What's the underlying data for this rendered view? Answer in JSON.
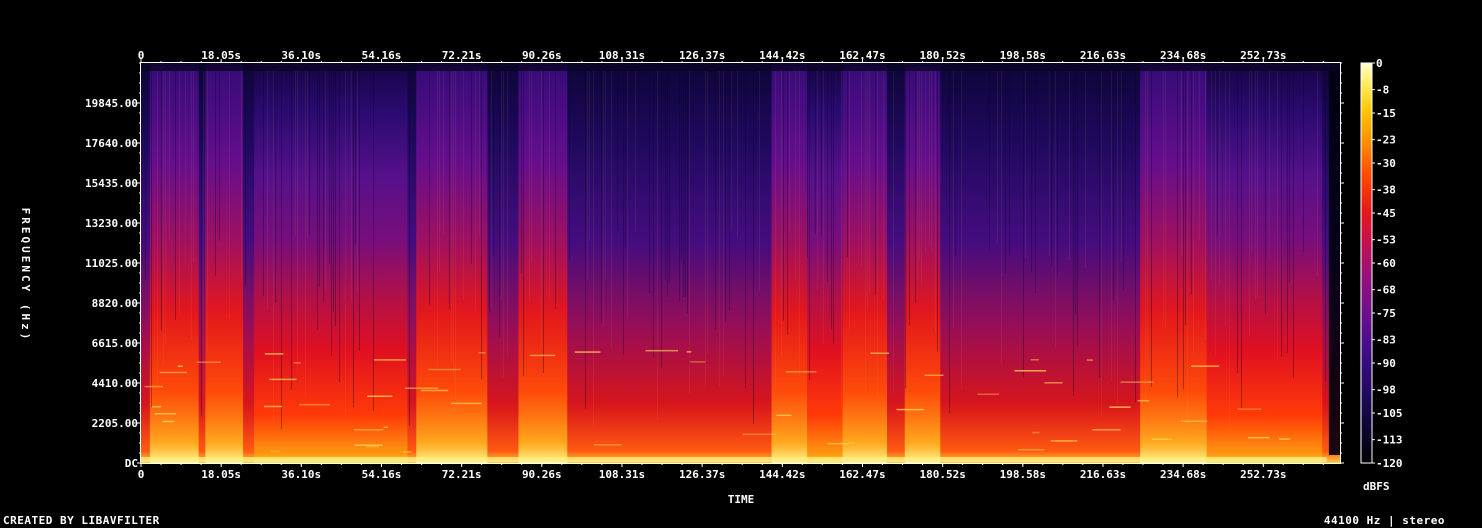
{
  "chart_data": {
    "type": "heatmap",
    "title": "",
    "xlabel": "TIME",
    "ylabel": "FREQUENCY (Hz)",
    "x_ticks": [
      "0",
      "18.05s",
      "36.10s",
      "54.16s",
      "72.21s",
      "90.26s",
      "108.31s",
      "126.37s",
      "144.42s",
      "162.47s",
      "180.52s",
      "198.58s",
      "216.63s",
      "234.68s",
      "252.73s"
    ],
    "x_tick_values": [
      0,
      18.05,
      36.1,
      54.16,
      72.21,
      90.26,
      108.31,
      126.37,
      144.42,
      162.47,
      180.52,
      198.58,
      216.63,
      234.68,
      252.73
    ],
    "xlim": [
      0,
      270
    ],
    "y_ticks": [
      "DC",
      "2205.00",
      "4410.00",
      "6615.00",
      "8820.00",
      "11025.00",
      "13230.00",
      "15435.00",
      "17640.00",
      "19845.00"
    ],
    "y_tick_values": [
      0,
      2205,
      4410,
      6615,
      8820,
      11025,
      13230,
      15435,
      17640,
      19845
    ],
    "ylim": [
      0,
      22050
    ],
    "colorbar": {
      "label": "dBFS",
      "ticks": [
        "0",
        "-8",
        "-15",
        "-23",
        "-30",
        "-38",
        "-45",
        "-53",
        "-60",
        "-68",
        "-75",
        "-83",
        "-90",
        "-98",
        "-105",
        "-113",
        "-120"
      ],
      "range": [
        -120,
        0
      ]
    },
    "colormap": [
      "#000000",
      "#0d0530",
      "#1d0a5c",
      "#3c0c86",
      "#6a0e8e",
      "#9a0f7a",
      "#c8104a",
      "#e81818",
      "#ff4a00",
      "#ff8c00",
      "#ffc800",
      "#ffee60",
      "#ffffd0"
    ]
  },
  "footer": {
    "left": "CREATED BY LIBAVFILTER",
    "right": "44100 Hz | stereo"
  }
}
